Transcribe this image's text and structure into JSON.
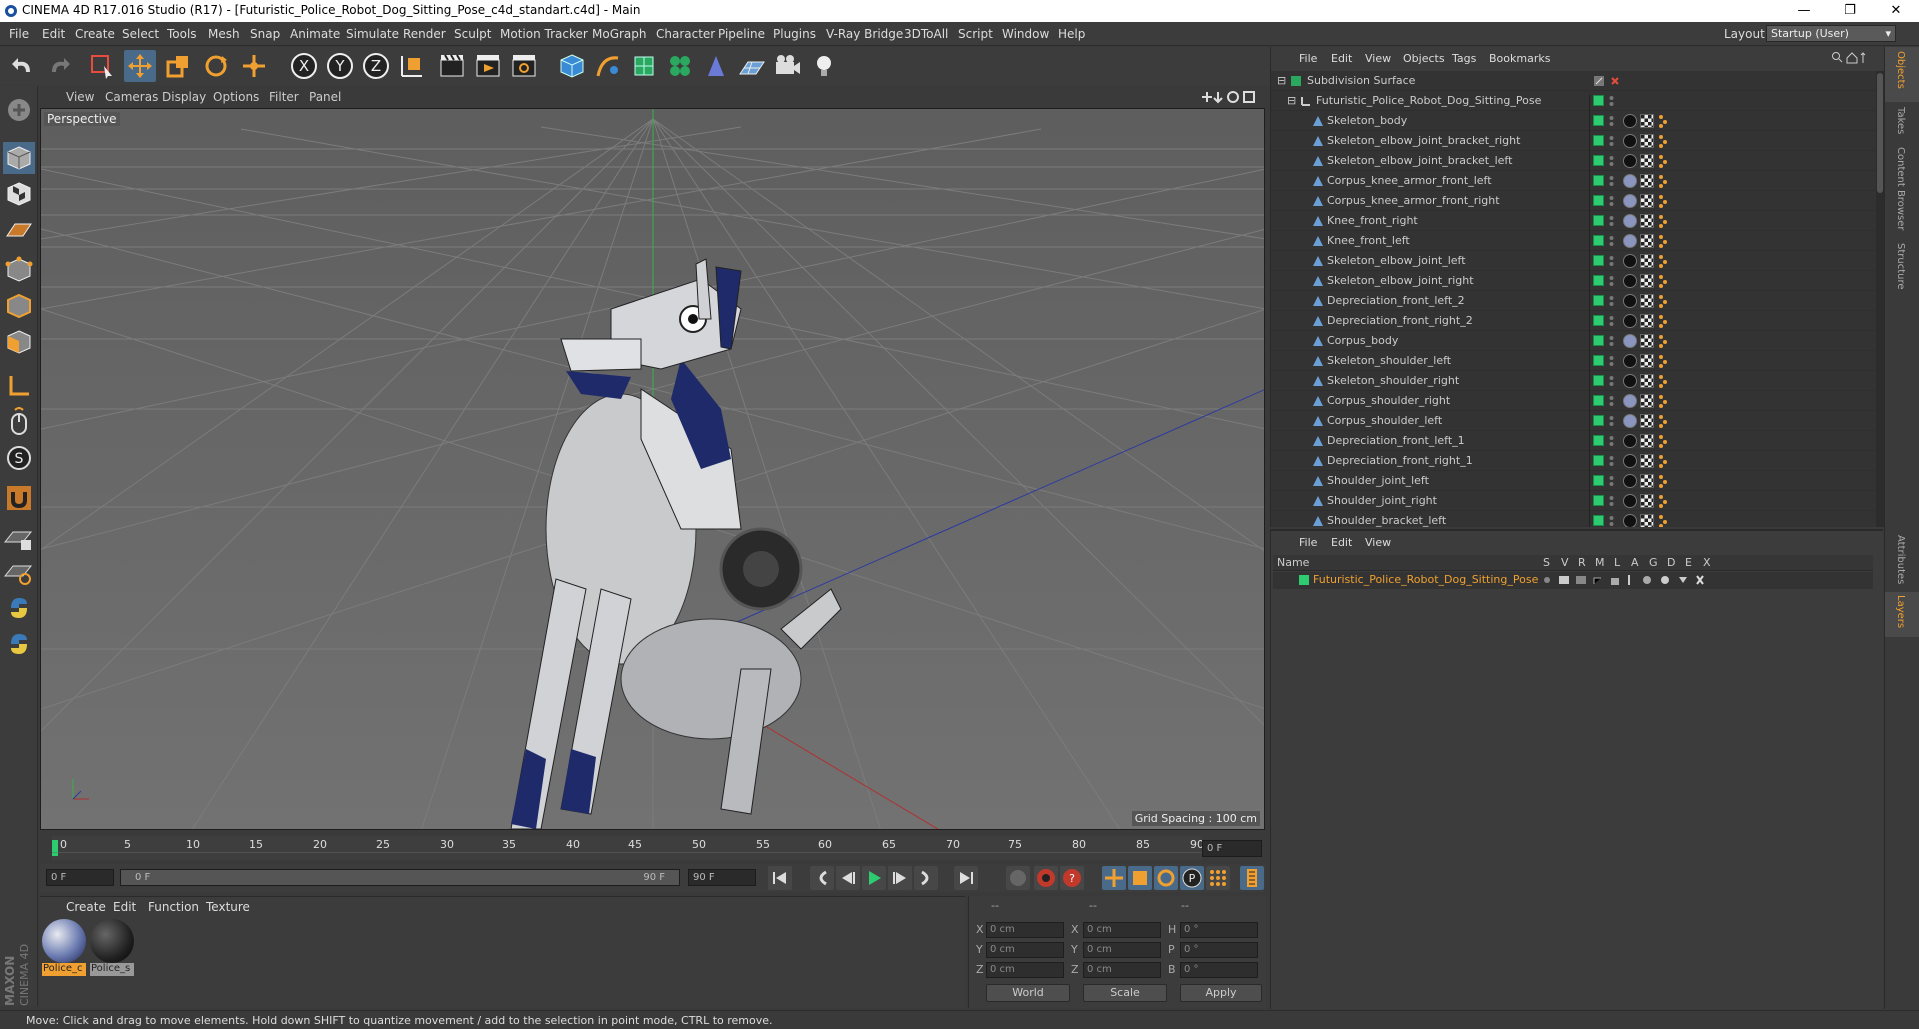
{
  "window": {
    "title": "CINEMA 4D R17.016 Studio (R17) - [Futuristic_Police_Robot_Dog_Sitting_Pose_c4d_standart.c4d] - Main",
    "minimize": "—",
    "maximize": "❐",
    "close": "✕"
  },
  "menu": [
    "File",
    "Edit",
    "Create",
    "Select",
    "Tools",
    "Mesh",
    "Snap",
    "Animate",
    "Simulate",
    "Render",
    "Sculpt",
    "Motion Tracker",
    "MoGraph",
    "Character",
    "Pipeline",
    "Plugins",
    "V-Ray Bridge",
    "3DToAll",
    "Script",
    "Window",
    "Help"
  ],
  "layout": {
    "label": "Layout:",
    "value": "Startup (User)"
  },
  "viewport": {
    "menu": [
      "View",
      "Cameras",
      "Display",
      "Options",
      "Filter",
      "Panel"
    ],
    "label": "Perspective",
    "grid_spacing": "Grid Spacing : 100 cm"
  },
  "timeline": {
    "ticks": [
      "0",
      "5",
      "10",
      "15",
      "20",
      "25",
      "30",
      "35",
      "40",
      "45",
      "50",
      "55",
      "60",
      "65",
      "70",
      "75",
      "80",
      "85",
      "90"
    ],
    "current_frame": "0 F",
    "start_field": "0 F",
    "range_start": "0 F",
    "range_end": "90 F",
    "end_field": "90 F"
  },
  "materials": {
    "menu": [
      "Create",
      "Edit",
      "Function",
      "Texture"
    ],
    "items": [
      {
        "label": "Police_c",
        "selected": true
      },
      {
        "label": "Police_s",
        "selected": false
      }
    ]
  },
  "coordinates": {
    "headers": [
      "--",
      "--",
      "--"
    ],
    "rows": [
      {
        "a": "X",
        "av": "0 cm",
        "b": "X",
        "bv": "0 cm",
        "c": "H",
        "cv": "0 °"
      },
      {
        "a": "Y",
        "av": "0 cm",
        "b": "Y",
        "bv": "0 cm",
        "c": "P",
        "cv": "0 °"
      },
      {
        "a": "Z",
        "av": "0 cm",
        "b": "Z",
        "bv": "0 cm",
        "c": "B",
        "cv": "0 °"
      }
    ],
    "mode1": "World",
    "mode2": "Scale",
    "apply": "Apply"
  },
  "status": "Move: Click and drag to move elements. Hold down SHIFT to quantize movement / add to the selection in point mode, CTRL to remove.",
  "object_manager": {
    "menu": [
      "File",
      "Edit",
      "View",
      "Objects",
      "Tags",
      "Bookmarks"
    ],
    "root": "Subdivision Surface",
    "group": "Futuristic_Police_Robot_Dog_Sitting_Pose",
    "objects": [
      "Skeleton_body",
      "Skeleton_elbow_joint_bracket_right",
      "Skeleton_elbow_joint_bracket_left",
      "Corpus_knee_armor_front_left",
      "Corpus_knee_armor_front_right",
      "Knee_front_right",
      "Knee_front_left",
      "Skeleton_elbow_joint_left",
      "Skeleton_elbow_joint_right",
      "Depreciation_front_left_2",
      "Depreciation_front_right_2",
      "Corpus_body",
      "Skeleton_shoulder_left",
      "Skeleton_shoulder_right",
      "Corpus_shoulder_right",
      "Corpus_shoulder_left",
      "Depreciation_front_left_1",
      "Depreciation_front_right_1",
      "Shoulder_joint_left",
      "Shoulder_joint_right",
      "Shoulder_bracket_left"
    ]
  },
  "layer_manager": {
    "menu": [
      "File",
      "Edit",
      "View"
    ],
    "columns": [
      "Name",
      "S",
      "V",
      "R",
      "M",
      "L",
      "A",
      "G",
      "D",
      "E",
      "X"
    ],
    "layer": "Futuristic_Police_Robot_Dog_Sitting_Pose",
    "layer_color": "#2ecc71"
  },
  "side_tabs": [
    "Objects",
    "Takes",
    "Content Browser",
    "Structure",
    "Attributes",
    "Layers"
  ],
  "brand": "MAXON CINEMA 4D",
  "colors": {
    "accent": "#f0a030",
    "green": "#2ecc71"
  }
}
